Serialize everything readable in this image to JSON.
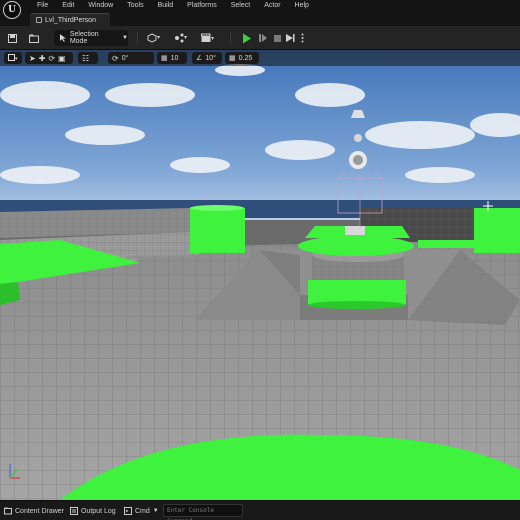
{
  "app": {
    "logo_letter": "U"
  },
  "menu": {
    "items": [
      {
        "label": "File"
      },
      {
        "label": "Edit"
      },
      {
        "label": "Window"
      },
      {
        "label": "Tools"
      },
      {
        "label": "Build"
      },
      {
        "label": "Platforms"
      },
      {
        "label": "Select"
      },
      {
        "label": "Actor"
      },
      {
        "label": "Help"
      }
    ]
  },
  "level_tab": {
    "label": "Lvl_ThirdPerson"
  },
  "toolbar": {
    "mode_label": "Selection Mode",
    "play_icon": "play-icon",
    "colors": {
      "play": "#3ccf3c"
    }
  },
  "viewport_toolbar": {
    "rotation_snap": "0°",
    "grid_snap": "10",
    "angle_snap": "10°",
    "scale_snap": "0.25"
  },
  "scene": {
    "colors": {
      "sky_top": "#4a7fc0",
      "sky_bottom": "#9dbbe0",
      "green": "#3ef23e",
      "floor": "#9a9a9a"
    }
  },
  "statusbar": {
    "content_drawer": "Content Drawer",
    "output_log": "Output Log",
    "cmd": "Cmd",
    "console_placeholder": "Enter Console Command"
  }
}
